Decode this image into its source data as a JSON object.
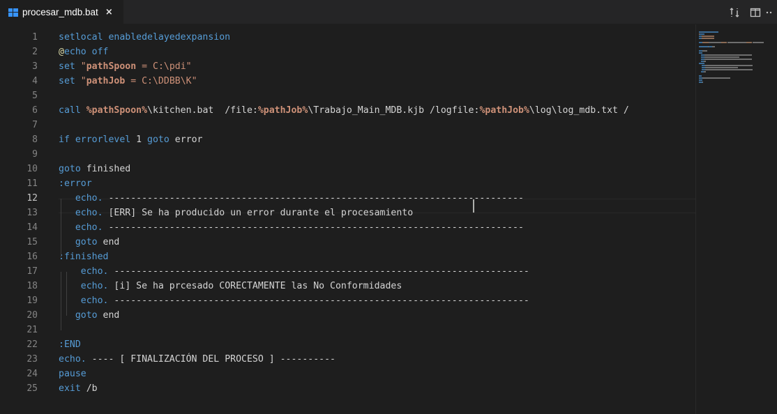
{
  "tab": {
    "icon": "windows-batch-icon",
    "filename": "procesar_mdb.bat",
    "close_glyph": "×"
  },
  "actions": [
    {
      "name": "open-changes-icon",
      "glyph": "⟲"
    },
    {
      "name": "split-editor-icon",
      "glyph": "◫"
    },
    {
      "name": "more-actions-icon",
      "glyph": "··"
    }
  ],
  "editor": {
    "current_line": 12,
    "lines": [
      {
        "n": "1",
        "segments": [
          {
            "t": "kw",
            "v": "setlocal enabledelayedexpansion"
          }
        ]
      },
      {
        "n": "2",
        "segments": [
          {
            "t": "fn",
            "v": "@"
          },
          {
            "t": "kw",
            "v": "echo off"
          }
        ]
      },
      {
        "n": "3",
        "segments": [
          {
            "t": "kw",
            "v": "set "
          },
          {
            "t": "str",
            "v": "\""
          },
          {
            "t": "var",
            "v": "pathSpoon"
          },
          {
            "t": "str",
            "v": " = C:\\pdi\""
          }
        ]
      },
      {
        "n": "4",
        "segments": [
          {
            "t": "kw",
            "v": "set "
          },
          {
            "t": "str",
            "v": "\""
          },
          {
            "t": "var",
            "v": "pathJob"
          },
          {
            "t": "str",
            "v": " = C:\\DDBB\\K\""
          }
        ]
      },
      {
        "n": "5",
        "segments": []
      },
      {
        "n": "6",
        "segments": [
          {
            "t": "kw",
            "v": "call "
          },
          {
            "t": "var",
            "v": "%pathSpoon%"
          },
          {
            "t": "plain",
            "v": "\\kitchen.bat  /file:"
          },
          {
            "t": "var",
            "v": "%pathJob%"
          },
          {
            "t": "plain",
            "v": "\\Trabajo_Main_MDB.kjb /logfile:"
          },
          {
            "t": "var",
            "v": "%pathJob%"
          },
          {
            "t": "plain",
            "v": "\\log\\log_mdb.txt /"
          }
        ]
      },
      {
        "n": "7",
        "segments": []
      },
      {
        "n": "8",
        "segments": [
          {
            "t": "kw",
            "v": "if errorlevel "
          },
          {
            "t": "plain",
            "v": "1 "
          },
          {
            "t": "kw",
            "v": "goto "
          },
          {
            "t": "plain",
            "v": "error"
          }
        ]
      },
      {
        "n": "9",
        "segments": []
      },
      {
        "n": "10",
        "segments": [
          {
            "t": "kw",
            "v": "goto "
          },
          {
            "t": "plain",
            "v": "finished"
          }
        ]
      },
      {
        "n": "11",
        "segments": [
          {
            "t": "label",
            "v": ":error"
          }
        ]
      },
      {
        "n": "12",
        "segments": [
          {
            "t": "plain",
            "v": "   "
          },
          {
            "t": "kw",
            "v": "echo. "
          },
          {
            "t": "plain",
            "v": "---------------------------------------------------------------------------"
          }
        ]
      },
      {
        "n": "13",
        "segments": [
          {
            "t": "plain",
            "v": "   "
          },
          {
            "t": "kw",
            "v": "echo. "
          },
          {
            "t": "plain",
            "v": "[ERR] Se ha producido un error durante el procesamiento"
          }
        ]
      },
      {
        "n": "14",
        "segments": [
          {
            "t": "plain",
            "v": "   "
          },
          {
            "t": "kw",
            "v": "echo. "
          },
          {
            "t": "plain",
            "v": "---------------------------------------------------------------------------"
          }
        ]
      },
      {
        "n": "15",
        "segments": [
          {
            "t": "plain",
            "v": "   "
          },
          {
            "t": "kw",
            "v": "goto "
          },
          {
            "t": "plain",
            "v": "end"
          }
        ]
      },
      {
        "n": "16",
        "segments": [
          {
            "t": "label",
            "v": ":finished"
          }
        ]
      },
      {
        "n": "17",
        "segments": [
          {
            "t": "plain",
            "v": "    "
          },
          {
            "t": "kw",
            "v": "echo. "
          },
          {
            "t": "plain",
            "v": "---------------------------------------------------------------------------"
          }
        ]
      },
      {
        "n": "18",
        "segments": [
          {
            "t": "plain",
            "v": "    "
          },
          {
            "t": "kw",
            "v": "echo. "
          },
          {
            "t": "plain",
            "v": "[i] Se ha prcesado CORECTAMENTE las No Conformidades"
          }
        ]
      },
      {
        "n": "19",
        "segments": [
          {
            "t": "plain",
            "v": "    "
          },
          {
            "t": "kw",
            "v": "echo. "
          },
          {
            "t": "plain",
            "v": "---------------------------------------------------------------------------"
          }
        ]
      },
      {
        "n": "20",
        "segments": [
          {
            "t": "plain",
            "v": "   "
          },
          {
            "t": "kw",
            "v": "goto "
          },
          {
            "t": "plain",
            "v": "end"
          }
        ]
      },
      {
        "n": "21",
        "segments": []
      },
      {
        "n": "22",
        "segments": [
          {
            "t": "label",
            "v": ":END"
          }
        ]
      },
      {
        "n": "23",
        "segments": [
          {
            "t": "kw",
            "v": "echo. "
          },
          {
            "t": "plain",
            "v": "---- [ FINALIZACIÓN DEL PROCESO ] ----------"
          }
        ]
      },
      {
        "n": "24",
        "segments": [
          {
            "t": "kw",
            "v": "pause"
          }
        ]
      },
      {
        "n": "25",
        "segments": [
          {
            "t": "kw",
            "v": "exit "
          },
          {
            "t": "plain",
            "v": "/b"
          }
        ]
      }
    ]
  },
  "colors": {
    "background": "#1e1e1e",
    "keyword": "#569cd6",
    "string": "#ce9178",
    "text": "#d4d4d4",
    "line_number": "#858585"
  }
}
